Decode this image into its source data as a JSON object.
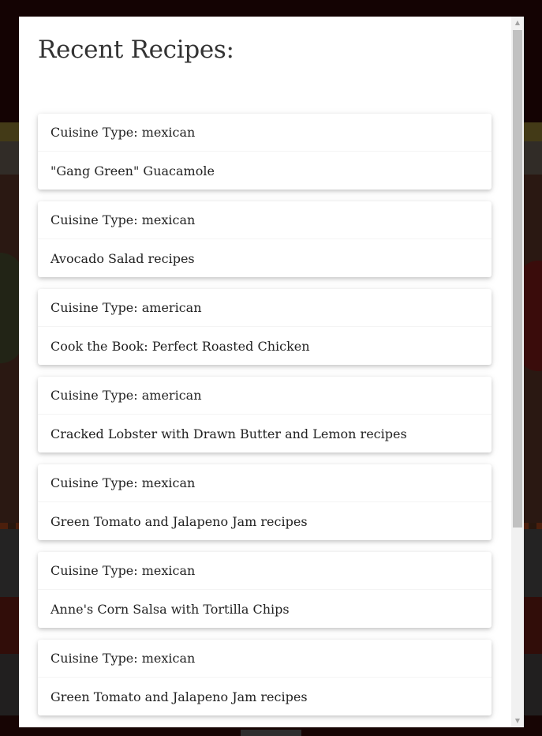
{
  "modal": {
    "title": "Recent Recipes:"
  },
  "recipes": [
    {
      "cuisine": "Cuisine Type: mexican",
      "name": "\"Gang Green\" Guacamole"
    },
    {
      "cuisine": "Cuisine Type: mexican",
      "name": "Avocado Salad recipes"
    },
    {
      "cuisine": "Cuisine Type: american",
      "name": "Cook the Book: Perfect Roasted Chicken"
    },
    {
      "cuisine": "Cuisine Type: american",
      "name": "Cracked Lobster with Drawn Butter and Lemon recipes"
    },
    {
      "cuisine": "Cuisine Type: mexican",
      "name": "Green Tomato and Jalapeno Jam recipes"
    },
    {
      "cuisine": "Cuisine Type: mexican",
      "name": "Anne's Corn Salsa with Tortilla Chips"
    },
    {
      "cuisine": "Cuisine Type: mexican",
      "name": "Green Tomato and Jalapeno Jam recipes"
    }
  ],
  "scrollbar": {
    "up_icon": "▲",
    "down_icon": "▼"
  }
}
